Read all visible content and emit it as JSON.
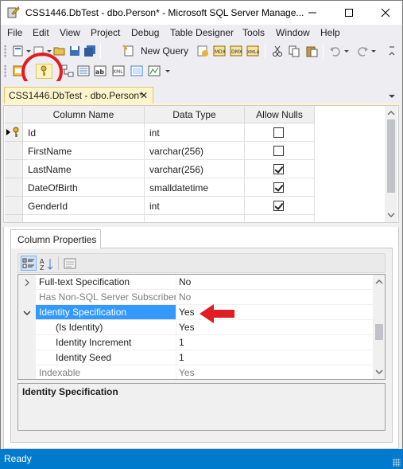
{
  "window": {
    "title": "CSS1446.DbTest - dbo.Person* - Microsoft SQL Server Manage...",
    "minimize_glyph": "—",
    "maximize_glyph": "☐",
    "close_glyph": "✕"
  },
  "menu": {
    "items": [
      {
        "label": "File"
      },
      {
        "label": "Edit"
      },
      {
        "label": "View"
      },
      {
        "label": "Project"
      },
      {
        "label": "Debug"
      },
      {
        "label": "Table Designer"
      },
      {
        "label": "Tools"
      },
      {
        "label": "Window"
      },
      {
        "label": "Help"
      }
    ]
  },
  "toolbar": {
    "new_query_label": "New Query"
  },
  "document_tab": {
    "label": "CSS1446.DbTest - dbo.Person*",
    "close_glyph": "✕"
  },
  "table_grid": {
    "headers": [
      "Column Name",
      "Data Type",
      "Allow Nulls"
    ],
    "rows": [
      {
        "name": "Id",
        "type": "int",
        "allow_nulls": false,
        "primary_key": true
      },
      {
        "name": "FirstName",
        "type": "varchar(256)",
        "allow_nulls": false,
        "primary_key": false
      },
      {
        "name": "LastName",
        "type": "varchar(256)",
        "allow_nulls": true,
        "primary_key": false
      },
      {
        "name": "DateOfBirth",
        "type": "smalldatetime",
        "allow_nulls": true,
        "primary_key": false
      },
      {
        "name": "GenderId",
        "type": "int",
        "allow_nulls": true,
        "primary_key": false
      }
    ]
  },
  "column_properties": {
    "tab_label": "Column Properties",
    "rows": [
      {
        "name": "Full-text Specification",
        "value": "No",
        "expander": "collapsed",
        "dim": false,
        "sub": false,
        "selected": false
      },
      {
        "name": "Has Non-SQL Server Subscriber",
        "value": "No",
        "expander": "none",
        "dim": true,
        "sub": false,
        "selected": false
      },
      {
        "name": "Identity Specification",
        "value": "Yes",
        "expander": "expanded",
        "dim": false,
        "sub": false,
        "selected": true
      },
      {
        "name": "(Is Identity)",
        "value": "Yes",
        "expander": "none",
        "dim": false,
        "sub": true,
        "selected": false
      },
      {
        "name": "Identity Increment",
        "value": "1",
        "expander": "none",
        "dim": false,
        "sub": true,
        "selected": false
      },
      {
        "name": "Identity Seed",
        "value": "1",
        "expander": "none",
        "dim": false,
        "sub": true,
        "selected": false
      },
      {
        "name": "Indexable",
        "value": "Yes",
        "expander": "none",
        "dim": true,
        "sub": false,
        "selected": false
      }
    ],
    "description_title": "Identity Specification"
  },
  "status": {
    "text": "Ready"
  },
  "colors": {
    "status_bar": "#007acc",
    "selection": "#3399ff",
    "annotation": "#e11c22",
    "tab_active": "#fff5cc"
  }
}
